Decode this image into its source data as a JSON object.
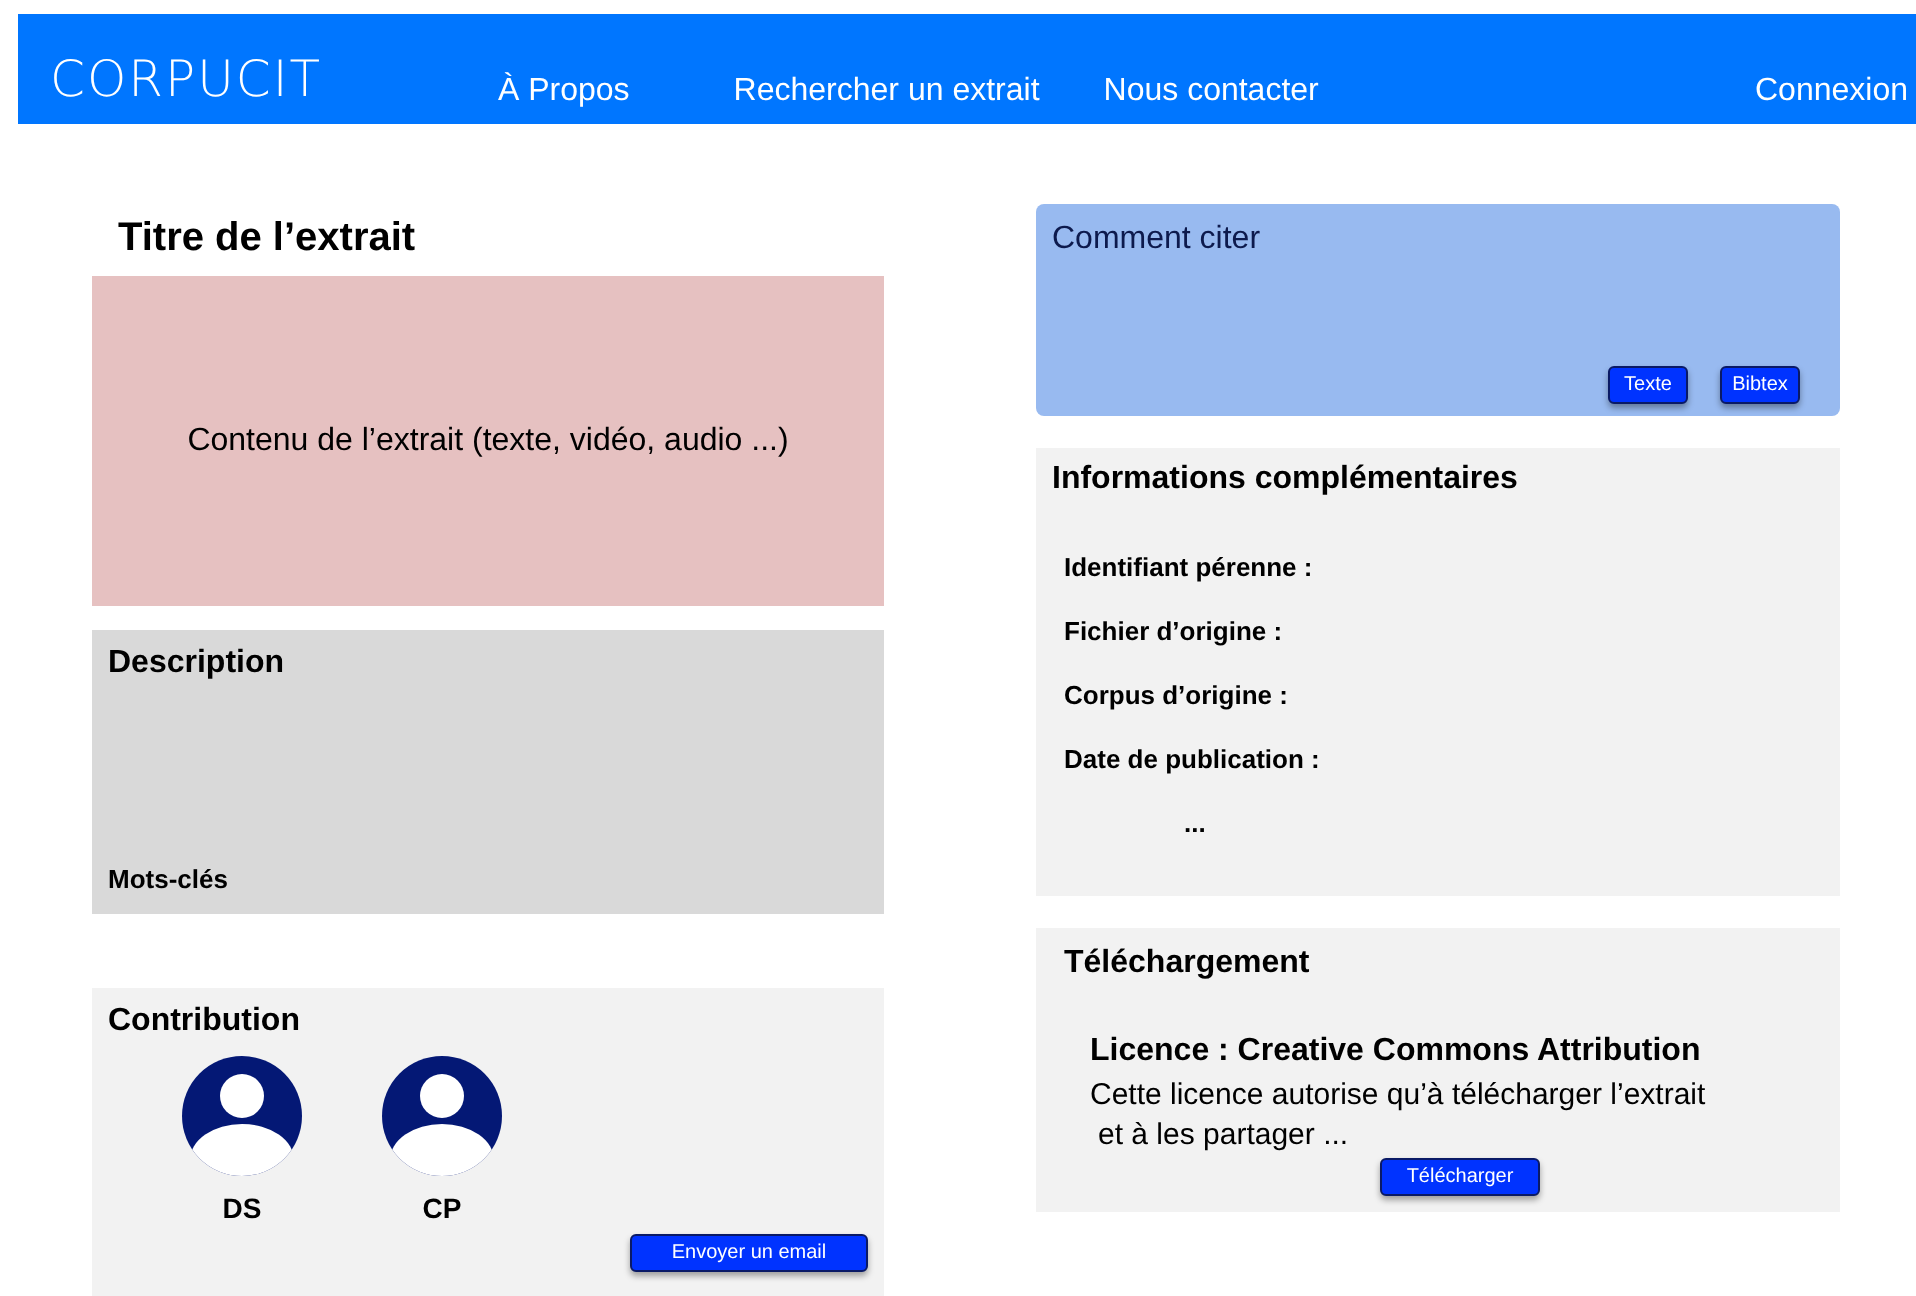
{
  "navbar": {
    "brand": "CORPUCIT",
    "links": [
      {
        "label": "À Propos"
      },
      {
        "label": "Rechercher un extrait"
      },
      {
        "label": "Nous contacter"
      }
    ],
    "login": "Connexion"
  },
  "title": "Titre de l’extrait",
  "content": {
    "text": "Contenu de l’extrait (texte, vidéo, audio ...)"
  },
  "description": {
    "heading": "Description",
    "keywords": "Mots-clés"
  },
  "contribution": {
    "heading": "Contribution",
    "contributors": [
      {
        "initials": "DS"
      },
      {
        "initials": "CP"
      }
    ],
    "button": "Envoyer un email"
  },
  "citation": {
    "heading": "Comment citer",
    "buttons": [
      "Texte",
      "Bibtex"
    ]
  },
  "info": {
    "heading": "Informations complémentaires",
    "fields": [
      "Identifiant pérenne :",
      "Fichier d’origine :",
      "Corpus d’origine :",
      "Date de publication :"
    ],
    "more": "..."
  },
  "download": {
    "heading": "Téléchargement",
    "license": "Licence : Creative Commons Attribution",
    "lines": [
      "Cette licence autorise qu’à télécharger l’extrait",
      "et à les partager ..."
    ],
    "button": "Télécharger"
  }
}
